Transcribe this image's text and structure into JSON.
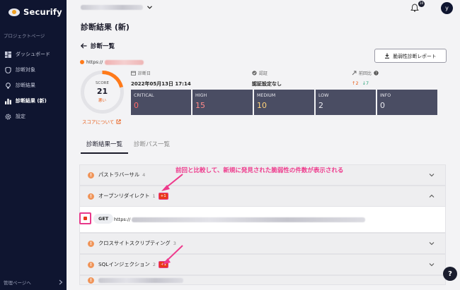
{
  "app": {
    "name": "Securify"
  },
  "sidebar": {
    "section_label": "プロジェクトページ",
    "items": [
      {
        "label": "ダッシュボード",
        "icon": "dashboard-icon"
      },
      {
        "label": "診断対象",
        "icon": "shield-icon"
      },
      {
        "label": "診断結果",
        "icon": "bulb-icon"
      },
      {
        "label": "診断結果 (新)",
        "icon": "bar-chart-icon",
        "active": true
      },
      {
        "label": "設定",
        "icon": "gear-icon"
      }
    ],
    "footer_label": "管理ページへ"
  },
  "header": {
    "notification_count": "10",
    "avatar_initial": "y"
  },
  "page": {
    "title": "診断結果 (新)",
    "back_label": "診断一覧",
    "report_button": "脆弱性診断レポート",
    "url_prefix": "https://"
  },
  "score": {
    "label": "SCORE",
    "value": "21",
    "grade": "悪い",
    "about_link": "スコアについて",
    "fraction": 0.21
  },
  "meta": {
    "date_label": "診断日",
    "date_value": "2022年05月13日 17:14",
    "auth_label": "認証",
    "auth_value": "認証設定なし",
    "compare_label": "前回比",
    "compare_up": "↑2",
    "compare_down": "↓7"
  },
  "severity": [
    {
      "label": "CRITICAL",
      "count": "0",
      "color": "#ff6b6b"
    },
    {
      "label": "HIGH",
      "count": "15",
      "color": "#ff8a8a"
    },
    {
      "label": "MEDIUM",
      "count": "10",
      "color": "#ffd27a"
    },
    {
      "label": "LOW",
      "count": "2",
      "color": "#e8e8ee"
    },
    {
      "label": "INFO",
      "count": "0",
      "color": "#e8e8ee"
    }
  ],
  "tabs": [
    {
      "label": "診断結果一覧",
      "active": true
    },
    {
      "label": "診断パス一覧",
      "active": false
    }
  ],
  "findings": [
    {
      "name": "パストラバーサル",
      "count": "4",
      "new": ""
    },
    {
      "name": "オープンリダイレクト",
      "count": "1",
      "new": "+1",
      "expanded": true
    },
    {
      "name": "クロスサイトスクリプティング",
      "count": "3",
      "new": ""
    },
    {
      "name": "SQLインジェクション",
      "count": "2",
      "new": "+1"
    }
  ],
  "detail": {
    "method": "GET",
    "url_prefix": "https://"
  },
  "annotation": "前回と比較して、新規に発見された脆弱性の件数が表示される",
  "colors": {
    "accent": "#e85a14",
    "sidebar": "#0f1530",
    "annotation": "#ee3a8c"
  }
}
